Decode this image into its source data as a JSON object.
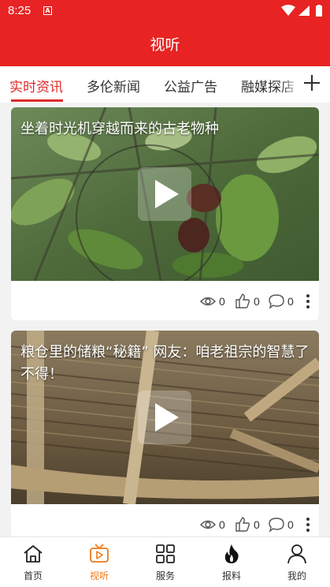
{
  "status": {
    "time": "8:25",
    "notification_icon": "a-icon"
  },
  "header": {
    "title": "视听"
  },
  "tabs": [
    {
      "label": "实时资讯",
      "active": true
    },
    {
      "label": "多伦新闻",
      "active": false
    },
    {
      "label": "公益广告",
      "active": false
    },
    {
      "label": "融媒探店",
      "active": false
    }
  ],
  "cards": [
    {
      "title": "坐着时光机穿越而来的古老物种",
      "views": "0",
      "likes": "0",
      "comments": "0"
    },
    {
      "title": "粮仓里的储粮“秘籍” 网友：咱老祖宗的智慧了不得！",
      "views": "0",
      "likes": "0",
      "comments": "0"
    }
  ],
  "nav": [
    {
      "label": "首页",
      "icon": "home-icon",
      "active": false
    },
    {
      "label": "视听",
      "icon": "tv-icon",
      "active": true
    },
    {
      "label": "服务",
      "icon": "grid-icon",
      "active": false
    },
    {
      "label": "报料",
      "icon": "fire-icon",
      "active": false
    },
    {
      "label": "我的",
      "icon": "user-icon",
      "active": false
    }
  ],
  "colors": {
    "brand_red": "#e82323",
    "active_tab": "#e02a2a",
    "active_nav": "#f07a1a"
  }
}
